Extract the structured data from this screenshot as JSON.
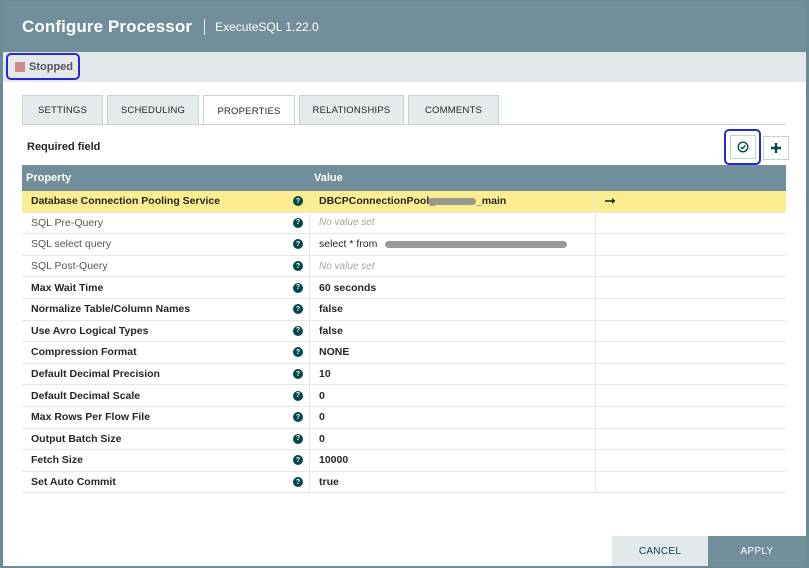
{
  "header": {
    "title": "Configure Processor",
    "subtitle": "ExecuteSQL 1.22.0"
  },
  "status": {
    "text": "Stopped",
    "color": "#d08a8a"
  },
  "tabs": [
    {
      "label": "SETTINGS",
      "active": false
    },
    {
      "label": "SCHEDULING",
      "active": false
    },
    {
      "label": "PROPERTIES",
      "active": true
    },
    {
      "label": "RELATIONSHIPS",
      "active": false
    },
    {
      "label": "COMMENTS",
      "active": false
    }
  ],
  "required_label": "Required field",
  "table": {
    "headers": {
      "property": "Property",
      "value": "Value"
    },
    "rows": [
      {
        "property": "Database Connection Pooling Service",
        "value": "DBCPConnectionPool_",
        "value_suffix": "_main",
        "required": true,
        "selected": true,
        "redacted": true,
        "action_icon": "arrow-right-icon"
      },
      {
        "property": "SQL Pre-Query",
        "value": "No value set",
        "required": false,
        "empty": true
      },
      {
        "property": "SQL select query",
        "value": "select * from",
        "required": false,
        "redacted": true
      },
      {
        "property": "SQL Post-Query",
        "value": "No value set",
        "required": false,
        "empty": true
      },
      {
        "property": "Max Wait Time",
        "value": "60 seconds",
        "required": true
      },
      {
        "property": "Normalize Table/Column Names",
        "value": "false",
        "required": true
      },
      {
        "property": "Use Avro Logical Types",
        "value": "false",
        "required": true
      },
      {
        "property": "Compression Format",
        "value": "NONE",
        "required": true
      },
      {
        "property": "Default Decimal Precision",
        "value": "10",
        "required": true
      },
      {
        "property": "Default Decimal Scale",
        "value": "0",
        "required": true
      },
      {
        "property": "Max Rows Per Flow File",
        "value": "0",
        "required": true
      },
      {
        "property": "Output Batch Size",
        "value": "0",
        "required": true
      },
      {
        "property": "Fetch Size",
        "value": "10000",
        "required": true
      },
      {
        "property": "Set Auto Commit",
        "value": "true",
        "required": true
      }
    ]
  },
  "buttons": {
    "cancel": "CANCEL",
    "apply": "APPLY"
  },
  "colors": {
    "header": "#728e9b",
    "selected_row": "#fcee90",
    "highlight_border": "#2828d6",
    "accent": "#004849"
  }
}
